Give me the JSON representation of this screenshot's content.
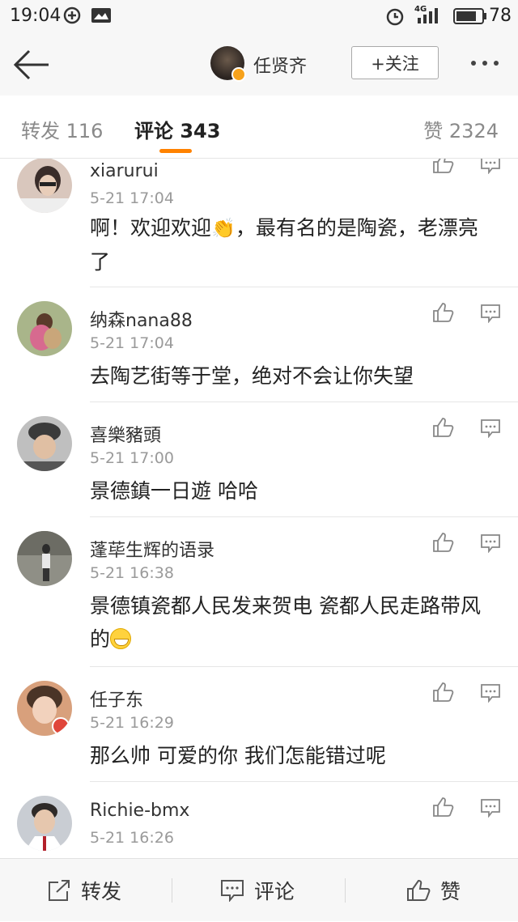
{
  "status_bar": {
    "time": "19:04",
    "network": "4G",
    "battery": "78"
  },
  "nav": {
    "title": "任贤齐",
    "follow_label": "+关注"
  },
  "tabs": {
    "repost": "转发 116",
    "comment": "评论 343",
    "like": "赞 2324"
  },
  "comments": [
    {
      "name": "xiarurui",
      "time": "5-21 17:04",
      "text_before": "啊！欢迎欢迎",
      "emoji": "clap",
      "text_after": "，最有名的是陶瓷，老漂亮了",
      "avatar_color": "#d9c7bd"
    },
    {
      "name": "纳森nana88",
      "time": "5-21 17:04",
      "text_before": "去陶艺街等于堂，绝对不会让你失望",
      "emoji": "",
      "text_after": "",
      "avatar_color": "#a9b58a"
    },
    {
      "name": "喜樂豬頭",
      "time": "5-21 17:00",
      "text_before": "景德鎮一日遊 哈哈",
      "emoji": "",
      "text_after": "",
      "avatar_color": "#6e6e6e"
    },
    {
      "name": "蓬荜生辉的语录",
      "time": "5-21 16:38",
      "text_before": "景德镇瓷都人民发来贺电 瓷都人民走路带风的",
      "emoji": "grin",
      "text_after": "",
      "avatar_color": "#8f8f86"
    },
    {
      "name": "任子东",
      "time": "5-21 16:29",
      "text_before": "那么帅 可爱的你 我们怎能错过呢",
      "emoji": "",
      "text_after": "",
      "avatar_color": "#d8a07c"
    },
    {
      "name": "Richie-bmx",
      "time": "5-21 16:26",
      "text_before": "",
      "emoji": "",
      "text_after": "",
      "avatar_color": "#c9cdd3"
    }
  ],
  "toolbar": {
    "repost": "转发",
    "comment": "评论",
    "like": "赞"
  },
  "colors": {
    "accent": "#ff8200",
    "verified_badge": "#f7a21b"
  }
}
